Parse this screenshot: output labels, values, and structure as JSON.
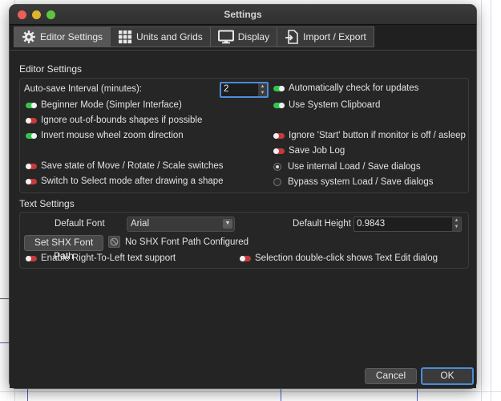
{
  "window": {
    "title": "Settings"
  },
  "tabs": [
    {
      "label": "Editor Settings",
      "icon": "gear-icon",
      "active": true
    },
    {
      "label": "Units and Grids",
      "icon": "grid-icon",
      "active": false
    },
    {
      "label": "Display",
      "icon": "monitor-icon",
      "active": false
    },
    {
      "label": "Import / Export",
      "icon": "import-export-icon",
      "active": false
    }
  ],
  "editor": {
    "title": "Editor Settings",
    "autosave_label": "Auto-save Interval (minutes):",
    "autosave_value": "2",
    "options": {
      "auto_check_updates": {
        "label": "Automatically check for updates",
        "on": true
      },
      "beginner_mode": {
        "label": "Beginner Mode (Simpler Interface)",
        "on": true
      },
      "system_clipboard": {
        "label": "Use System Clipboard",
        "on": true
      },
      "ignore_oob": {
        "label": "Ignore out-of-bounds shapes if possible",
        "on": false
      },
      "invert_wheel": {
        "label": "Invert mouse wheel zoom direction",
        "on": true
      },
      "ignore_start": {
        "label": "Ignore 'Start' button if monitor is off / asleep",
        "on": false
      },
      "save_job_log": {
        "label": "Save Job Log",
        "on": false
      },
      "save_switch_state": {
        "label": "Save state of Move / Rotate / Scale switches",
        "on": false
      },
      "switch_select": {
        "label": "Switch to Select mode after drawing a shape",
        "on": false
      }
    },
    "dialogs": {
      "internal": {
        "label": "Use internal Load / Save dialogs",
        "checked": true
      },
      "system": {
        "label": "Bypass system Load / Save dialogs",
        "checked": false
      }
    }
  },
  "text": {
    "title": "Text Settings",
    "font_label": "Default Font",
    "font_value": "Arial",
    "height_label": "Default Height",
    "height_value": "0.9843",
    "shx_button": "Set SHX Font Path",
    "shx_status": "No SHX Font Path Configured",
    "rtl": {
      "label": "Enable Right-To-Left text support",
      "on": false
    },
    "dblclick": {
      "label": "Selection double-click shows Text Edit dialog",
      "on": false
    }
  },
  "footer": {
    "cancel": "Cancel",
    "ok": "OK"
  },
  "colors": {
    "toggle_on": "#32c54c",
    "toggle_off": "#c53a3a",
    "accent": "#4a8cdc"
  }
}
